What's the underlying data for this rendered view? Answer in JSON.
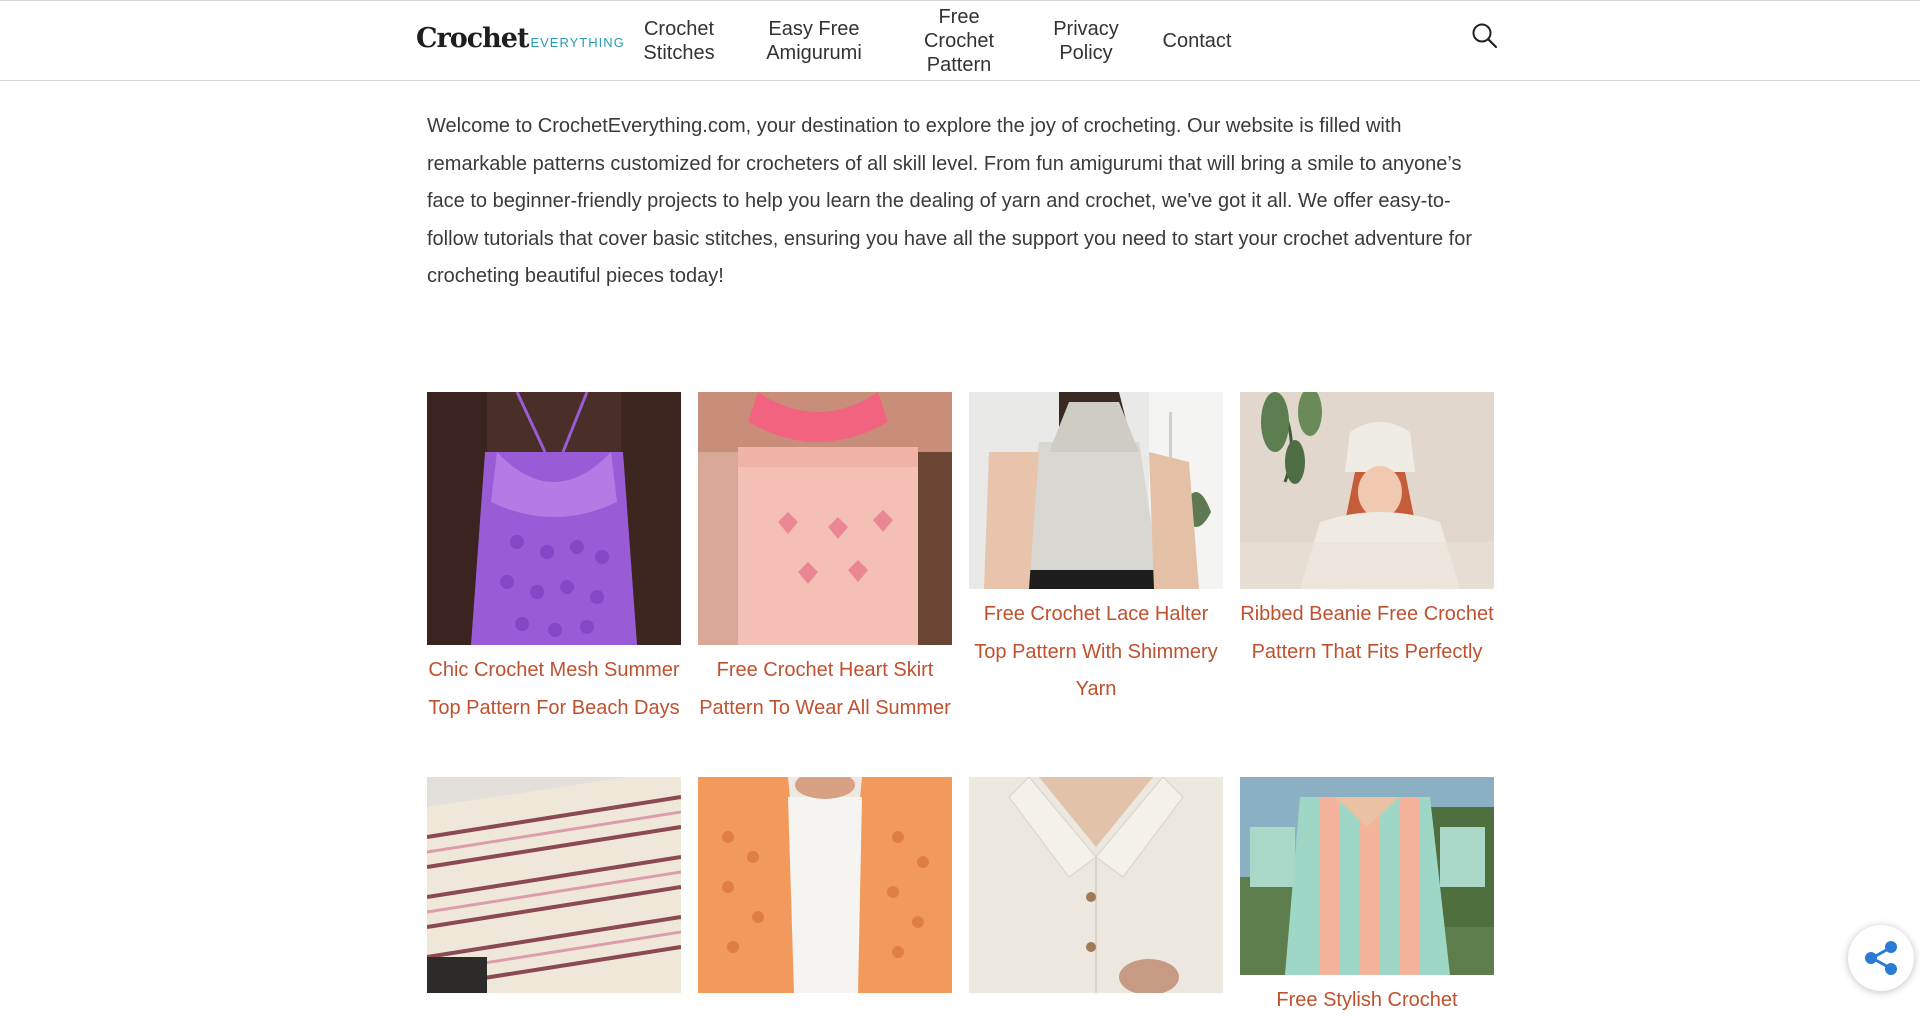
{
  "header": {
    "logo_main": "Crochet",
    "logo_sub": "EVERYTHING",
    "nav": [
      {
        "lines": [
          "Crochet",
          "Stitches"
        ]
      },
      {
        "lines": [
          "Easy Free",
          "Amigurumi"
        ]
      },
      {
        "lines": [
          "Free",
          "Crochet",
          "Pattern"
        ]
      },
      {
        "lines": [
          "Privacy",
          "Policy"
        ]
      },
      {
        "lines": [
          "Contact"
        ]
      }
    ],
    "search_icon": "search-icon"
  },
  "intro": {
    "text": "Welcome to CrochetEverything.com, your destination to explore the joy of crocheting. Our website is filled with remarkable patterns customized for crocheters of all skill level. From fun amigurumi that will bring a smile to anyone’s face to beginner-friendly projects to help you learn the dealing of yarn and crochet, we've got it all. We offer easy-to-follow tutorials that cover basic stitches, ensuring you have all the support you need to start your crochet adventure for crocheting beautiful pieces today!"
  },
  "posts": [
    {
      "title": "Chic Crochet Mesh Summer Top Pattern For Beach Days",
      "image": "purple crochet mesh top"
    },
    {
      "title": "Free Crochet Heart Skirt Pattern To Wear All Summer",
      "image": "pink crochet heart skirt"
    },
    {
      "title": "Free Crochet Lace Halter Top Pattern With Shimmery Yarn",
      "image": "white lace halter top"
    },
    {
      "title": "Ribbed Beanie Free Crochet Pattern That Fits Perfectly",
      "image": "cream ribbed beanie"
    },
    {
      "title": "",
      "image": "striped crochet blanket"
    },
    {
      "title": "",
      "image": "orange crochet cardigan"
    },
    {
      "title": "",
      "image": "cream crochet button shirt"
    },
    {
      "title": "Free Stylish Crochet",
      "image": "mint and peach striped crochet shirt"
    }
  ],
  "colors": {
    "link": "#c0512f",
    "body_text": "#3a3a3a",
    "logo_accent": "#2a9bb0",
    "share": "#2b7bd4"
  },
  "share_icon": "share-icon"
}
